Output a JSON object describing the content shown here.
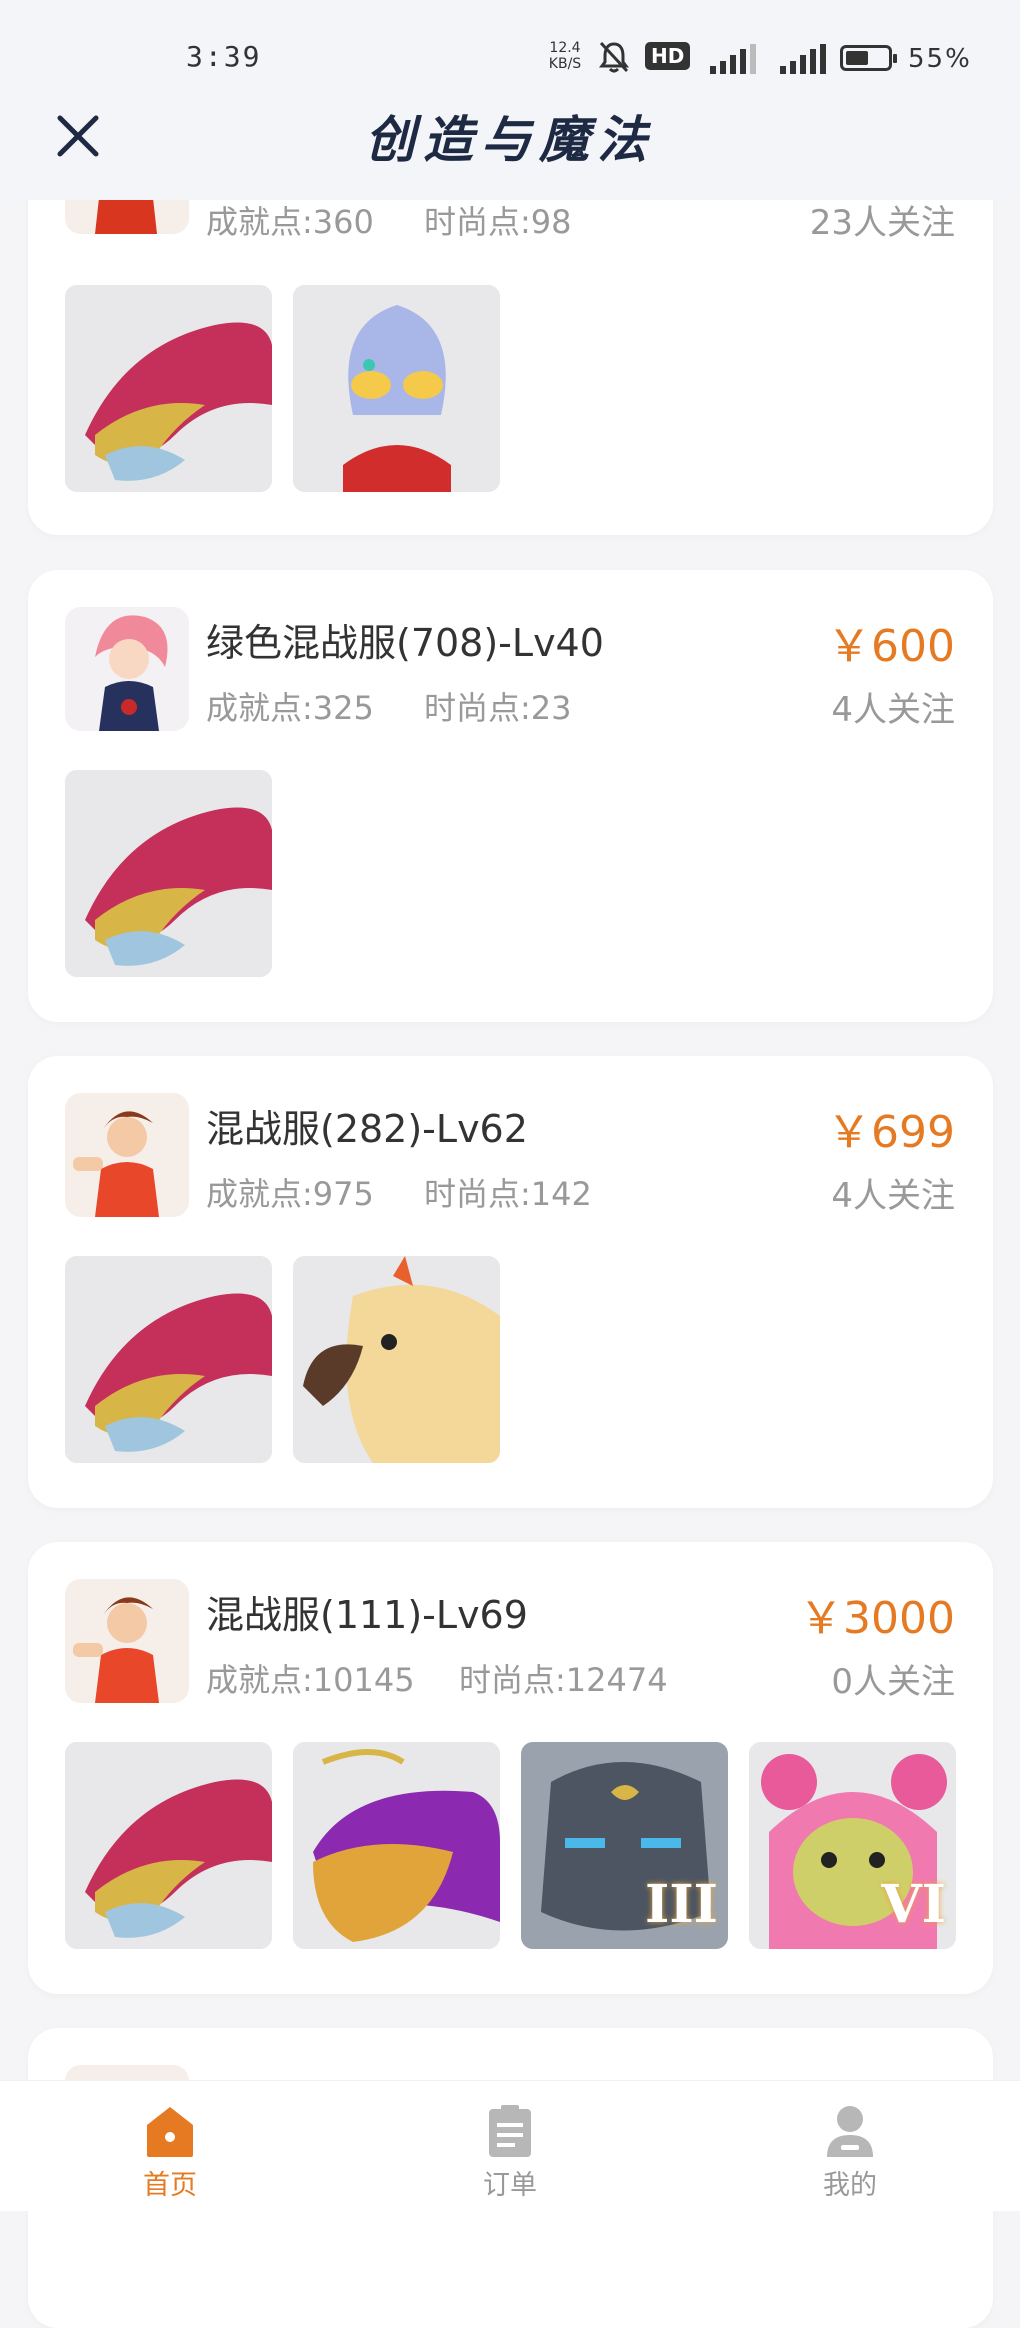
{
  "status_bar": {
    "time": "3:39",
    "net_speed_value": "12.4",
    "net_speed_unit": "KB/S",
    "hd_label": "HD",
    "battery_percent": "55%",
    "battery_level": 0.55
  },
  "header": {
    "title": "创造与魔法"
  },
  "listings": [
    {
      "name": "",
      "price": "",
      "achievement": "成就点:360",
      "fashion": "时尚点:98",
      "followers": "23人关注",
      "avatar": "boy-red-outfit",
      "items": [
        "dragon-mount",
        "ultraman-pet"
      ]
    },
    {
      "name": "绿色混战服(708)-Lv40",
      "price": "￥600",
      "achievement": "成就点:325",
      "fashion": "时尚点:23",
      "followers": "4人关注",
      "avatar": "girl-pink-hair",
      "items": [
        "dragon-mount"
      ]
    },
    {
      "name": "混战服(282)-Lv62",
      "price": "￥699",
      "achievement": "成就点:975",
      "fashion": "时尚点:142",
      "followers": "4人关注",
      "avatar": "boy-red-outfit",
      "items": [
        "dragon-mount",
        "parrot-mount"
      ]
    },
    {
      "name": "混战服(111)-Lv69",
      "price": "￥3000",
      "achievement": "成就点:10145",
      "fashion": "时尚点:12474",
      "followers": "0人关注",
      "avatar": "boy-red-outfit",
      "items": [
        "dragon-mount",
        "golden-whale-mount",
        "stone-golem-pet",
        "pink-bear-pet"
      ],
      "item_badges": [
        "",
        "",
        "III",
        "VI"
      ]
    }
  ],
  "bottom_nav": {
    "items": [
      {
        "label": "首页",
        "icon": "home-icon",
        "active": true
      },
      {
        "label": "订单",
        "icon": "order-icon",
        "active": false
      },
      {
        "label": "我的",
        "icon": "profile-icon",
        "active": false
      }
    ]
  },
  "colors": {
    "accent": "#e67a23",
    "title": "#1e2a44",
    "muted": "#999999",
    "background": "#f5f5f7"
  }
}
